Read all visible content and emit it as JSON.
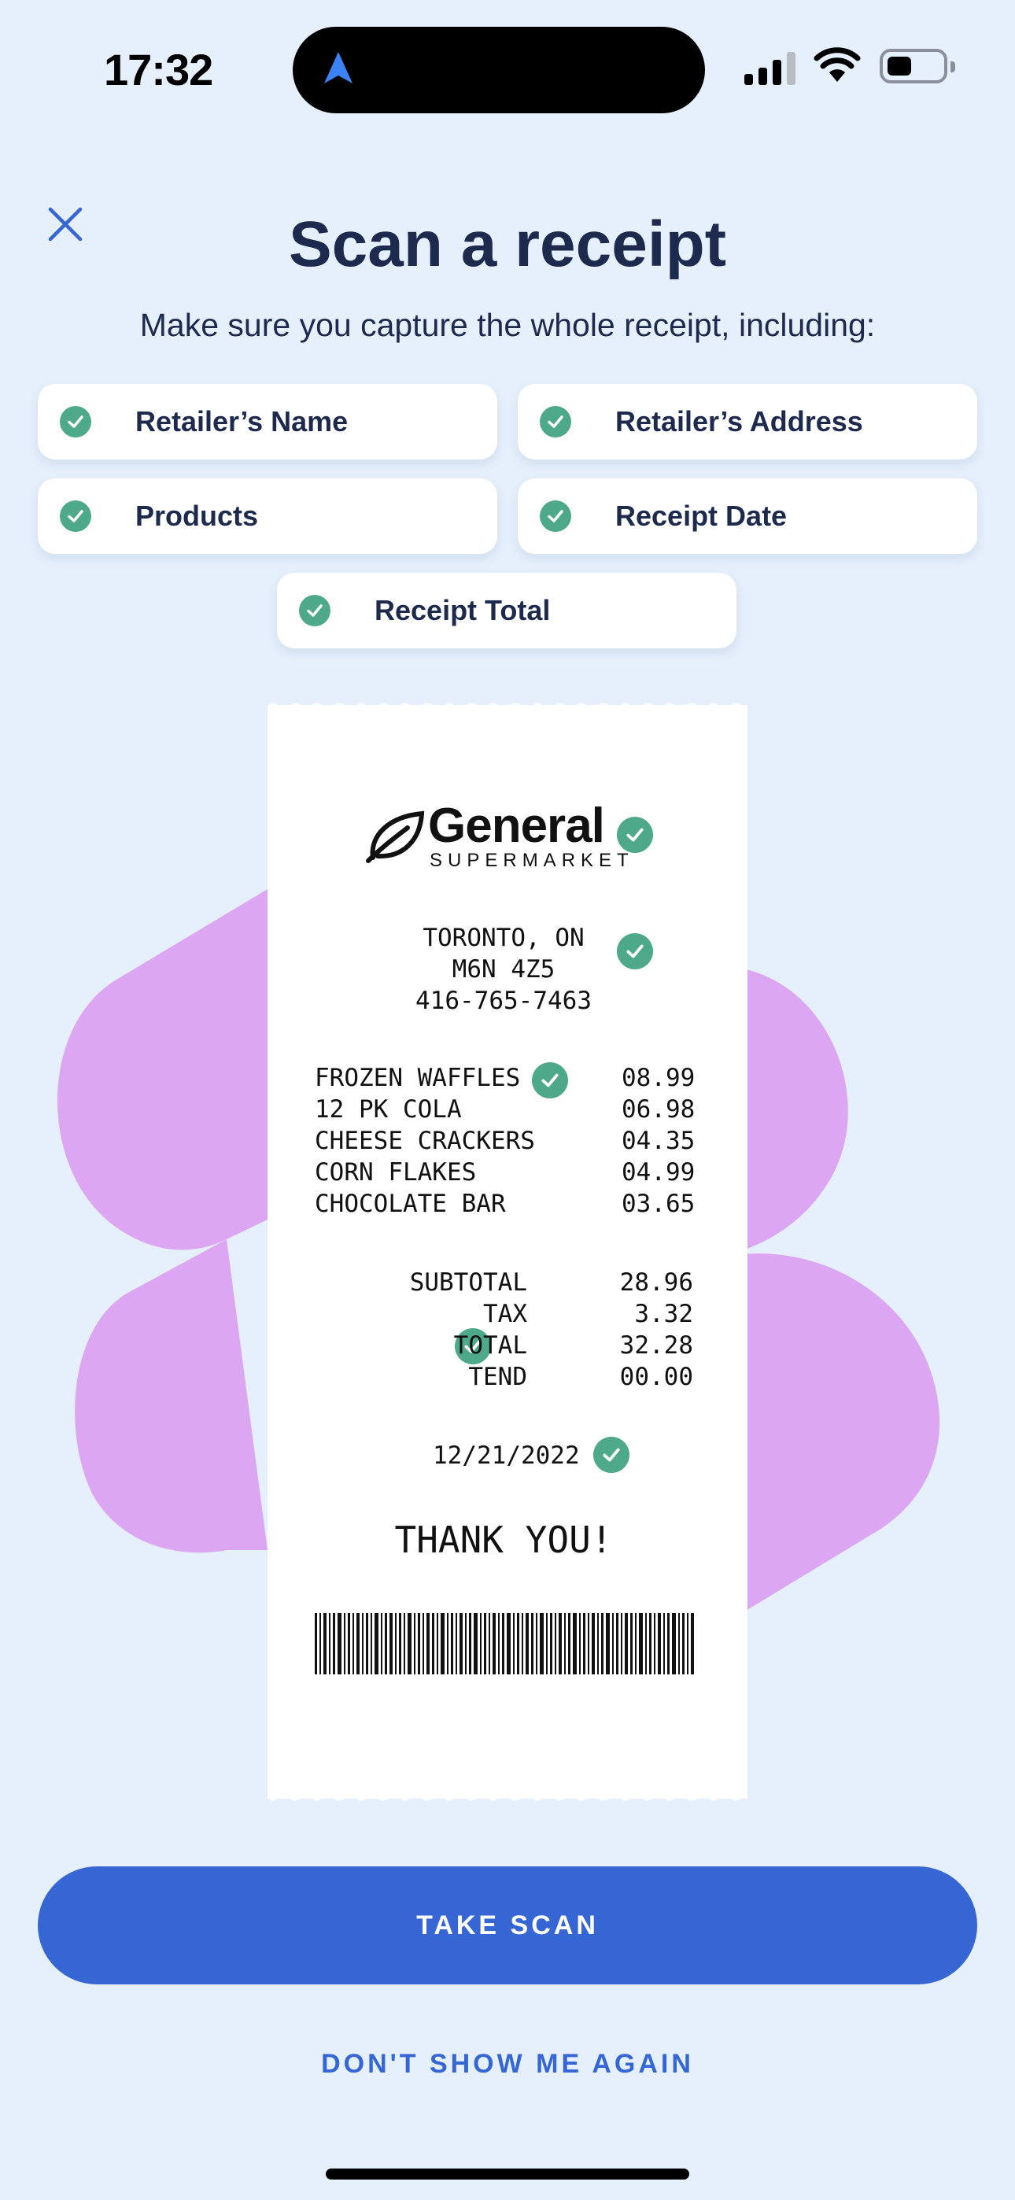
{
  "status_bar": {
    "time": "17:32"
  },
  "header": {
    "title": "Scan a receipt",
    "subtitle": "Make sure you capture the whole receipt, including:"
  },
  "checklist": [
    {
      "label": "Retailer’s Name"
    },
    {
      "label": "Retailer’s Address"
    },
    {
      "label": "Products"
    },
    {
      "label": "Receipt Date"
    },
    {
      "label": "Receipt Total"
    }
  ],
  "receipt": {
    "store_name": "General",
    "store_type": "SUPERMARKET",
    "address_line1": "TORONTO, ON",
    "address_line2": "M6N 4Z5",
    "phone": "416-765-7463",
    "items": [
      {
        "name": "FROZEN WAFFLES",
        "price": "08.99"
      },
      {
        "name": "12 PK COLA",
        "price": "06.98"
      },
      {
        "name": "CHEESE CRACKERS",
        "price": "04.35"
      },
      {
        "name": "CORN FLAKES",
        "price": "04.99"
      },
      {
        "name": "CHOCOLATE BAR",
        "price": "03.65"
      }
    ],
    "totals": [
      {
        "label": "SUBTOTAL",
        "value": "28.96"
      },
      {
        "label": "TAX",
        "value": "3.32"
      },
      {
        "label": "TOTAL",
        "value": "32.28"
      },
      {
        "label": "TEND",
        "value": "00.00"
      }
    ],
    "date": "12/21/2022",
    "thanks": "THANK YOU!"
  },
  "actions": {
    "primary": "TAKE SCAN",
    "secondary": "DON'T SHOW ME AGAIN"
  },
  "colors": {
    "background": "#e6f0fc",
    "accent": "#3566d4",
    "check": "#4ea88a",
    "blob": "#dca6f3",
    "title": "#1d2a4d"
  }
}
